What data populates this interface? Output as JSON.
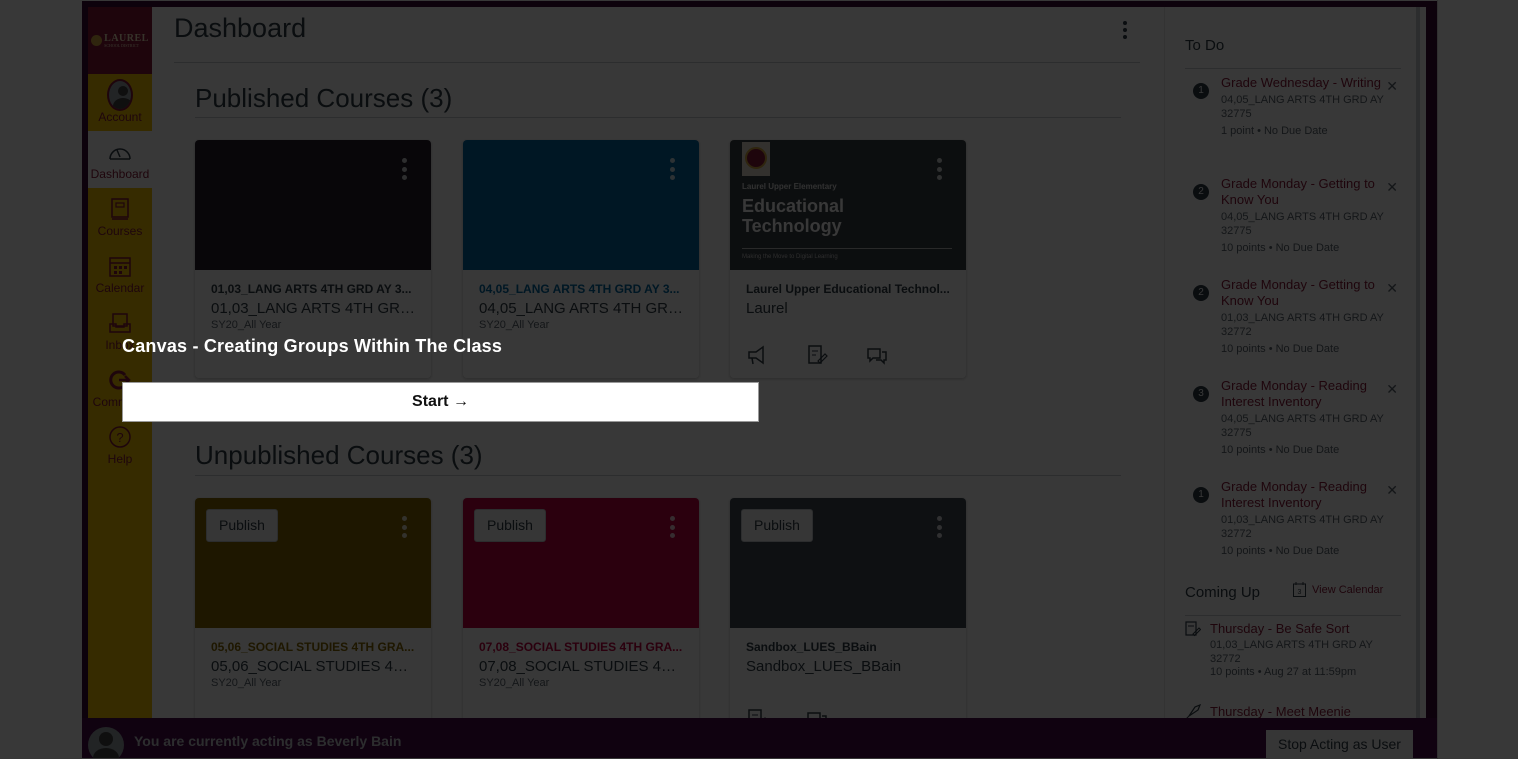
{
  "logo": {
    "name": "LAUREL",
    "subtitle": "SCHOOL DISTRICT"
  },
  "sidebar": {
    "items": [
      {
        "label": "Account",
        "icon": "avatar"
      },
      {
        "label": "Dashboard",
        "icon": "speedometer-icon",
        "active": true
      },
      {
        "label": "Courses",
        "icon": "book-icon"
      },
      {
        "label": "Calendar",
        "icon": "calendar-icon"
      },
      {
        "label": "Inbox",
        "icon": "inbox-icon"
      },
      {
        "label": "Commons",
        "icon": "commons-icon"
      },
      {
        "label": "Help",
        "icon": "help-icon"
      }
    ]
  },
  "header": {
    "title": "Dashboard",
    "menu_icon": "kebab-icon"
  },
  "published": {
    "title": "Published Courses (3)",
    "courses": [
      {
        "title": "01,03_LANG ARTS 4TH GRD AY 3...",
        "subtitle": "01,03_LANG ARTS 4TH GRD ...",
        "term": "SY20_All Year",
        "color": "#241d2b",
        "title_color": "#2d3b45"
      },
      {
        "title": "04,05_LANG ARTS 4TH GRD AY 3...",
        "subtitle": "04,05_LANG ARTS 4TH GRD ...",
        "term": "SY20_All Year",
        "color": "#006ba6",
        "title_color": "#006ba6"
      },
      {
        "title": "Laurel Upper Educational Technol...",
        "subtitle": "Laurel",
        "term": "",
        "color": "#3a3f45",
        "title_color": "#2d3b45",
        "image_text": {
          "line1": "Laurel Upper Elementary",
          "line2": "Educational",
          "line3": "Technology",
          "line4": "Making the Move to Digital Learning"
        }
      }
    ]
  },
  "unpublished": {
    "title": "Unpublished Courses (3)",
    "publish_label": "Publish",
    "courses": [
      {
        "title": "05,06_SOCIAL STUDIES 4TH GRA...",
        "subtitle": "05,06_SOCIAL STUDIES 4TH ...",
        "term": "SY20_All Year",
        "color": "#8a6a00",
        "title_color": "#8a6a00"
      },
      {
        "title": "07,08_SOCIAL STUDIES 4TH GRA...",
        "subtitle": "07,08_SOCIAL STUDIES 4TH ...",
        "term": "SY20_All Year",
        "color": "#c4003f",
        "title_color": "#c4003f"
      },
      {
        "title": "Sandbox_LUES_BBain",
        "subtitle": "Sandbox_LUES_BBain",
        "term": "",
        "color": "#3f4a55",
        "title_color": "#2d3b45"
      }
    ]
  },
  "todo": {
    "title": "To Do",
    "items": [
      {
        "badge": "1",
        "title": "Grade Wednesday - Writing",
        "course": "04,05_LANG ARTS 4TH GRD AY 32775",
        "meta": "1 point • No Due Date"
      },
      {
        "badge": "2",
        "title": "Grade Monday - Getting to Know You",
        "course": "04,05_LANG ARTS 4TH GRD AY 32775",
        "meta": "10 points • No Due Date"
      },
      {
        "badge": "2",
        "title": "Grade Monday - Getting to Know You",
        "course": "01,03_LANG ARTS 4TH GRD AY 32772",
        "meta": "10 points • No Due Date"
      },
      {
        "badge": "3",
        "title": "Grade Monday - Reading Interest Inventory",
        "course": "04,05_LANG ARTS 4TH GRD AY 32775",
        "meta": "10 points • No Due Date"
      },
      {
        "badge": "1",
        "title": "Grade Monday - Reading Interest Inventory",
        "course": "01,03_LANG ARTS 4TH GRD AY 32772",
        "meta": "10 points • No Due Date"
      }
    ]
  },
  "coming_up": {
    "title": "Coming Up",
    "view_calendar": "View Calendar",
    "calendar_day": "3",
    "items": [
      {
        "icon": "assignment-icon",
        "title": "Thursday - Be Safe Sort",
        "course": "01,03_LANG ARTS 4TH GRD AY 32772",
        "meta": "10 points • Aug 27 at 11:59pm"
      },
      {
        "icon": "rocket-icon",
        "title": "Thursday - Meet Meenie",
        "course": "",
        "meta": ""
      }
    ]
  },
  "masquerade": {
    "text": "You are currently acting as Beverly Bain",
    "stop_label": "Stop Acting as User"
  },
  "walkthrough": {
    "title": "Canvas - Creating Groups Within The Class",
    "start_label": "Start →"
  }
}
